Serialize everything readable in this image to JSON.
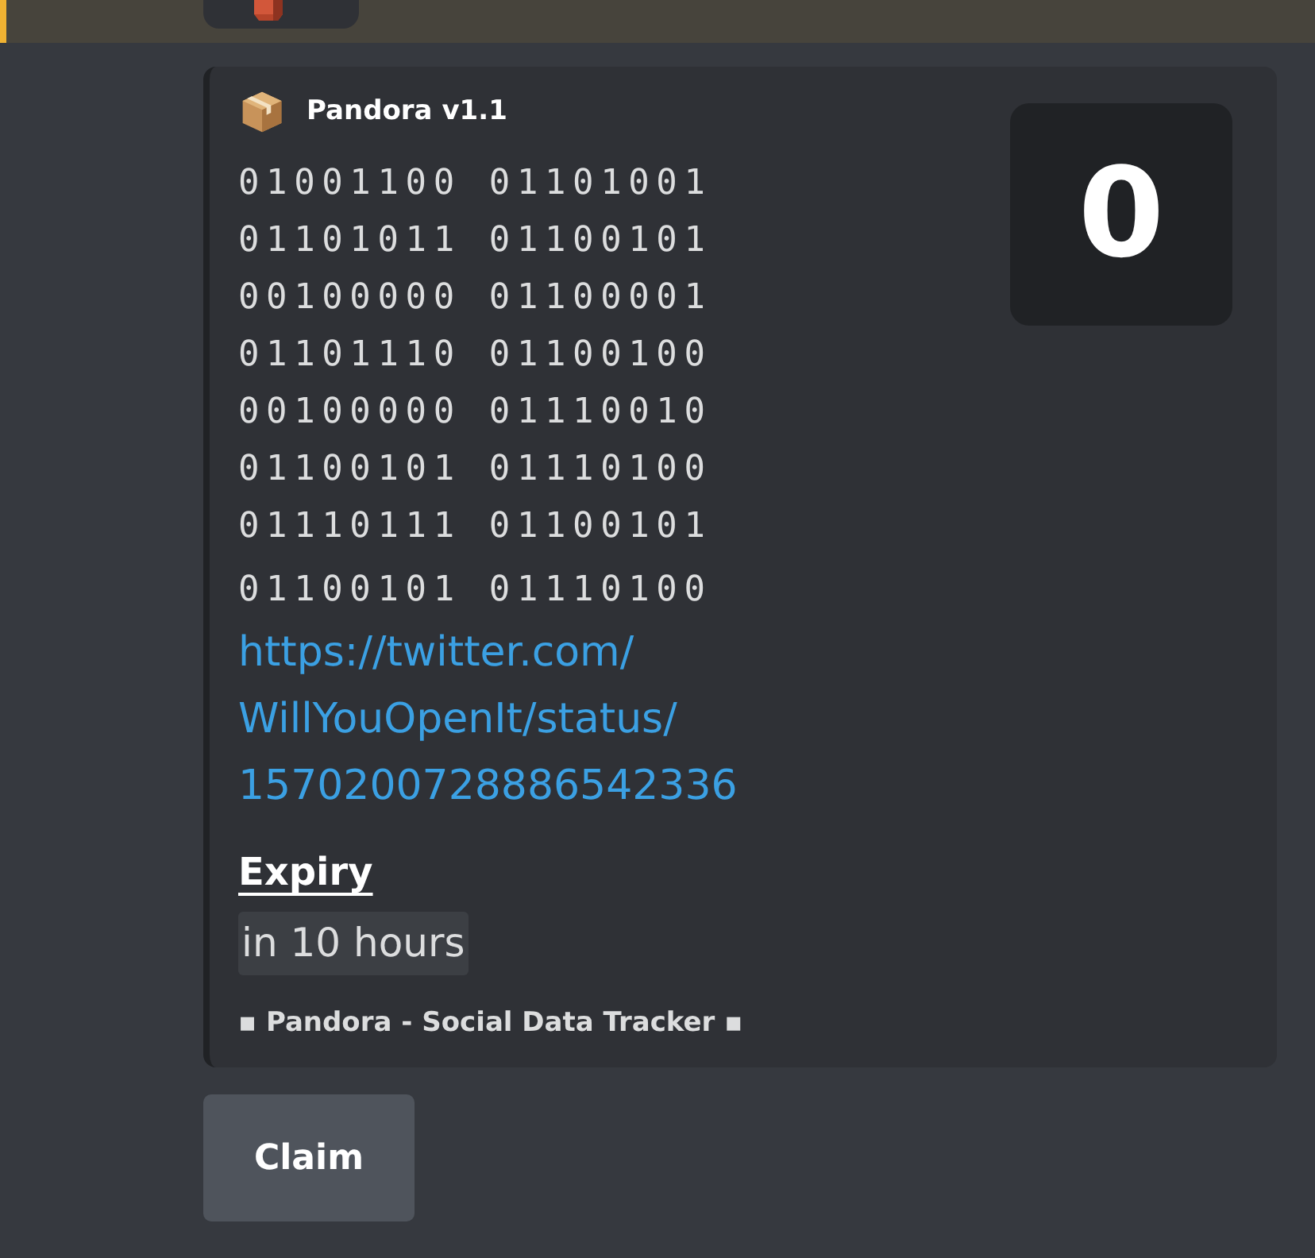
{
  "previous_message": {
    "highlighted": true
  },
  "embed": {
    "title": "Pandora v1.1",
    "lines": [
      "01001100 01101001",
      "01101011 01100101",
      "00100000 01100001",
      "01101110 01100100",
      "00100000 01110010",
      "01100101 01110100",
      "01110111 01100101",
      "01100101 01110100"
    ],
    "link": "https://twitter.com/WillYouOpenIt/status/1570200728886542336",
    "thumbnail_text": "0",
    "fields": [
      {
        "name": "Expiry",
        "value": "in 10 hours"
      }
    ],
    "footer": "▪ Pandora - Social Data Tracker ▪"
  },
  "buttons": [
    {
      "label": "Claim"
    }
  ]
}
